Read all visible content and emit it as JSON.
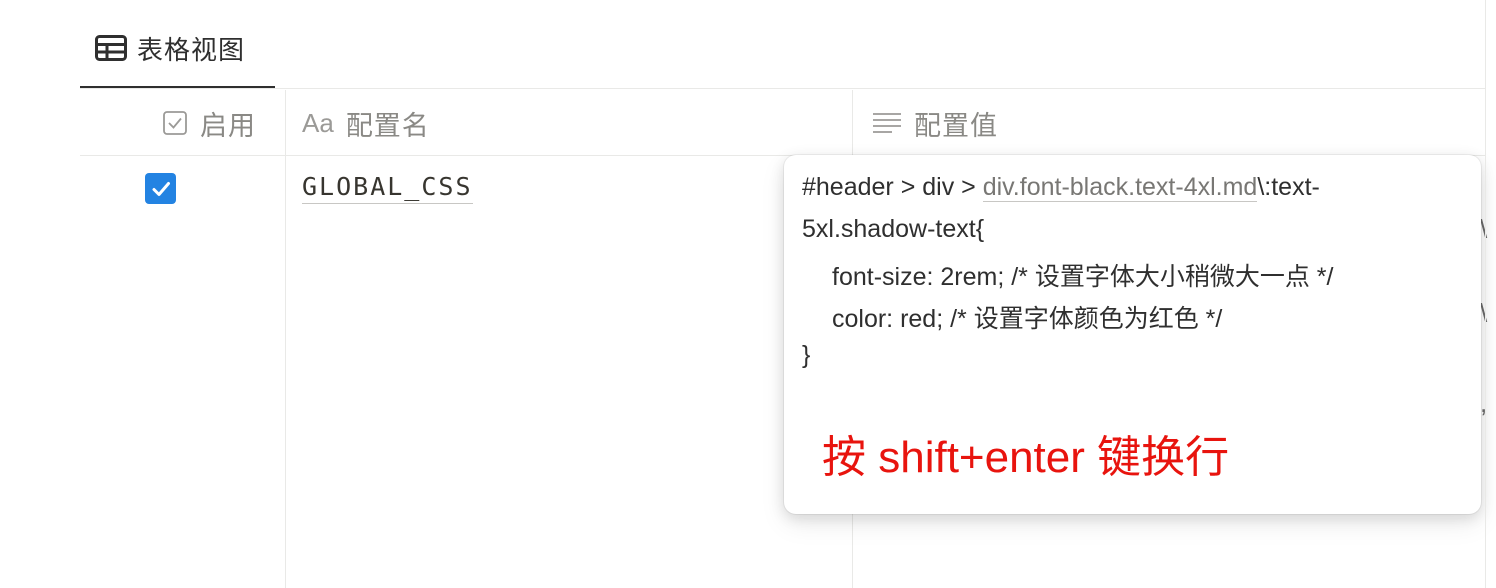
{
  "view_tab": {
    "label": "表格视图",
    "icon": "table-icon"
  },
  "columns": [
    {
      "label": "启用",
      "icon": "checkbox-icon"
    },
    {
      "label": "配置名",
      "icon_text": "Aa"
    },
    {
      "label": "配置值",
      "icon": "text-lines-icon"
    }
  ],
  "row": {
    "enabled": true,
    "config_name": "GLOBAL_CSS"
  },
  "editor": {
    "line1_prefix": "#header > div > ",
    "line1_link": "div.font-black.text-4xl.md",
    "line1_suffix": "\\:text-",
    "line2": "5xl.shadow-text{",
    "line3": "font-size: 2rem; /* 设置字体大小稍微大一点 */",
    "line4": "color: red; /* 设置字体颜色为红色 */",
    "line5": "}",
    "hint": "按 shift+enter 键换行",
    "hint_color": "#e8140e"
  },
  "colors": {
    "accent": "#2383e2",
    "text": "#37352f",
    "muted": "#8a8985",
    "border": "#e9e9e7"
  }
}
